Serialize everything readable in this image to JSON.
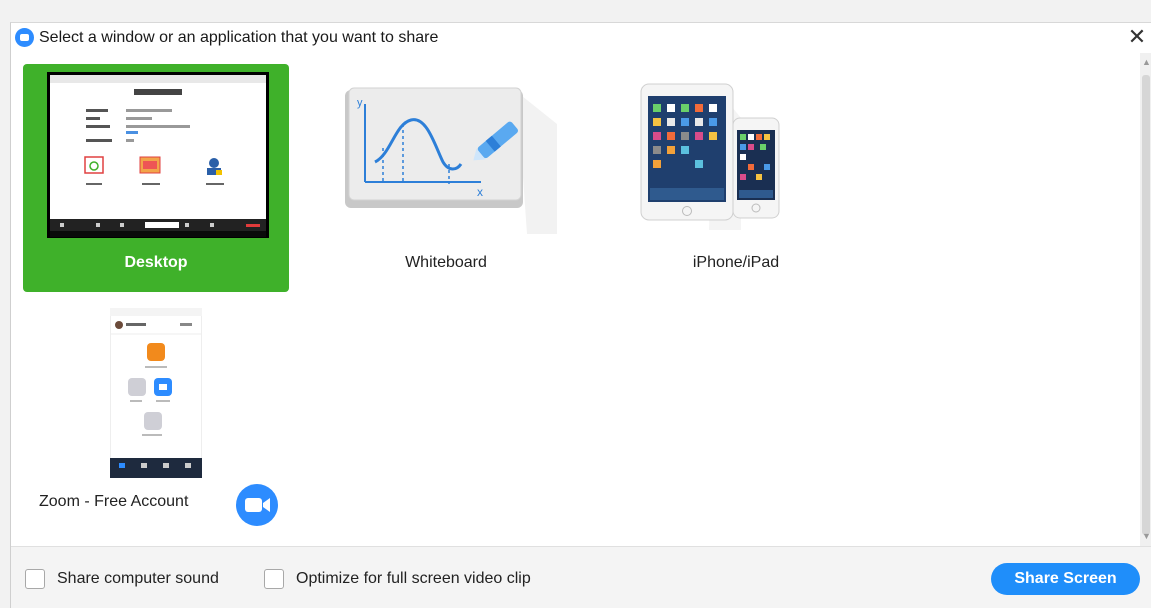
{
  "dialog": {
    "title": "Select a window or an application that you want to share",
    "close_glyph": "✕"
  },
  "tiles": {
    "desktop": {
      "label": "Desktop",
      "selected": true
    },
    "whiteboard": {
      "label": "Whiteboard"
    },
    "iphone_ipad": {
      "label": "iPhone/iPad"
    },
    "zoom_app": {
      "label": "Zoom - Free Account"
    }
  },
  "footer": {
    "share_sound_label": "Share computer sound",
    "optimize_video_label": "Optimize for full screen video clip",
    "share_button_label": "Share Screen"
  },
  "colors": {
    "selected_tile": "#3fb12a",
    "share_button": "#1f8efa",
    "zoom_blue": "#2d8cff"
  },
  "icons": {
    "title_logo": "zoom-logo-icon",
    "close": "close-icon",
    "zoom_app": "zoom-camera-icon"
  }
}
